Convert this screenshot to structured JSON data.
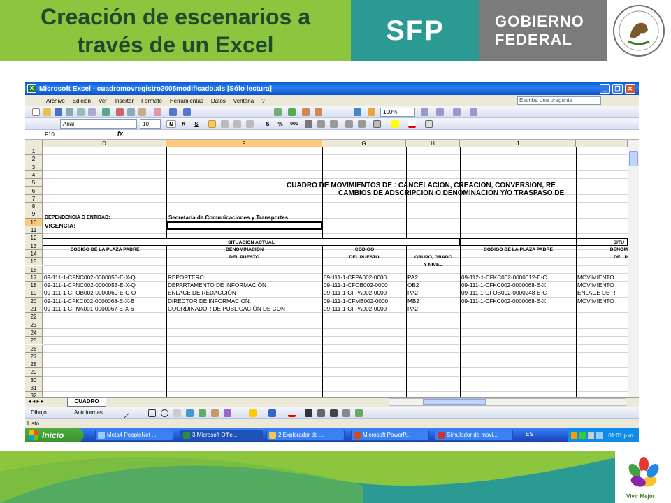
{
  "slide": {
    "title_line1": "Creación de escenarios a",
    "title_line2": "través de un Excel",
    "sfp": "SFP",
    "gobierno_line1": "GOBIERNO",
    "gobierno_line2": "FEDERAL",
    "vivir_mejor": "Vivir Mejor"
  },
  "window": {
    "title": "Microsoft Excel - cuadromovregistro2005modificado.xls  [Sólo lectura]",
    "minimize": "_",
    "restore": "❐",
    "close": "✕"
  },
  "menu": [
    "Archivo",
    "Edición",
    "Ver",
    "Insertar",
    "Formato",
    "Herramientas",
    "Datos",
    "Ventana",
    "?"
  ],
  "help_box": "Escriba una pregunta",
  "toolbar": {
    "zoom": "100%",
    "font": "Arial",
    "size": "10",
    "bold": "N",
    "italic": "K",
    "underline": "S",
    "currency": "$",
    "percent": "%",
    "thousands": "000"
  },
  "formula_bar": {
    "name_box": "F10",
    "fx": "fx"
  },
  "columns": [
    "D",
    "F",
    "G",
    "H",
    "J"
  ],
  "rows": [
    "1",
    "2",
    "3",
    "4",
    "5",
    "6",
    "7",
    "8",
    "9",
    "10",
    "11",
    "12",
    "13",
    "14",
    "15",
    "16",
    "17",
    "18",
    "19",
    "20",
    "21",
    "22",
    "23",
    "24",
    "25",
    "26",
    "27",
    "28",
    "29",
    "30",
    "31",
    "32"
  ],
  "sheet": {
    "title1": "CUADRO DE MOVIMIENTOS DE : CANCELACION, CREACION, CONVERSION, RE",
    "title2": "CAMBIOS DE ADSCRIPCION O DENOMINACION Y/O TRASPASO DE",
    "dependencia_label": "DEPENDENCIA O ENTIDAD:",
    "dependencia_value": "Secretaría de Comunicaciones y Transportes",
    "vigencia_label": "VIGENCIA:",
    "situacion_actual": "SITUACION ACTUAL",
    "situacion_right": "SITU",
    "headers": {
      "codigo_plaza_padre": "CODIGO DE LA PLAZA PADRE",
      "denominacion": "DENOMINACION",
      "del_puesto": "DEL PUESTO",
      "codigo": "CODIGO",
      "codigo_del_puesto": "DEL PUESTO",
      "grupo_grado": "GRUPO, GRADO",
      "y_nivel": "Y NIVEL",
      "codigo_plaza_padre_r": "CODIGO DE LA PLAZA PADRE",
      "denom_r": "DENOM",
      "del_p_r": "DEL P"
    },
    "data_rows": [
      {
        "row": "17",
        "d": "09-111-1-CFNC002-0000053-E-X-Q",
        "f": "REPORTERO.",
        "g": "09-111-1-CFPA002-0000",
        "h": "PA2",
        "j": "09-112-1-CFKC002-0000012-E-C",
        "k": "MOVIMIENTO"
      },
      {
        "row": "18",
        "d": "09-111-1-CFNC002-0000053-E-X-Q",
        "f": "DEPARTAMENTO DE INFORMACIÓN",
        "g": "09-111-1-CFOB002-0000",
        "h": "OB2",
        "j": "09-111-1-CFKC002-0000068-E-X",
        "k": "MOVIMIENTO"
      },
      {
        "row": "19",
        "d": "09-111-1-CFOB002-0000069-E-C-O",
        "f": "ENLACE DE REDACCIÓN",
        "g": "09-111-1-CFPA002-0000",
        "h": "PA2",
        "j": "09-111-1-CFOB002-0000248-E-C",
        "k": "ENLACE DE R"
      },
      {
        "row": "20",
        "d": "09-111-1-CFKC002-0000068-E-X-B",
        "f": "DIRECTOR DE INFORMACION.",
        "g": "09-111-1-CFMB002-0000",
        "h": "MB2",
        "j": "09-111-1-CFKC002-0000068-E-X",
        "k": "MOVIMIENTO"
      },
      {
        "row": "21",
        "d": "09-111-1-CFNA001-0000067-E-X-6",
        "f": "COORDINADOR DE PUBLICACIÓN DE CON",
        "g": "09-111-1-CFPA002-0000",
        "h": "PA2",
        "j": "",
        "k": ""
      }
    ]
  },
  "sheet_tab": "CUADRO",
  "drawing_bar": {
    "dibujo": "Dibujo",
    "autoformas": "Autoformas"
  },
  "status": "Listo",
  "taskbar": {
    "start": "Inicio",
    "tasks": [
      "Meta4 PeopleNet ...",
      "3 Microsoft Offic...",
      "2 Explorador de ...",
      "Microsoft PowerP...",
      "Simulador de movi..."
    ],
    "lang": "ES",
    "clock": "01:01 p.m."
  }
}
